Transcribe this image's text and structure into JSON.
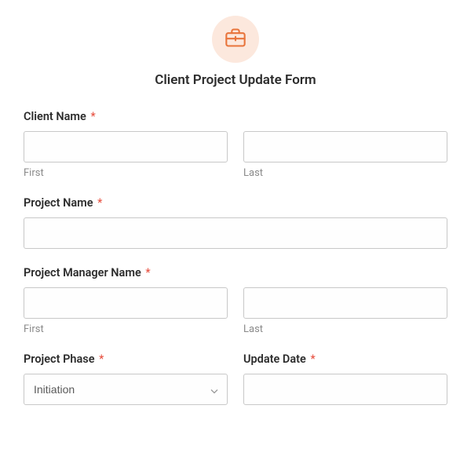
{
  "header": {
    "title": "Client Project Update Form"
  },
  "fields": {
    "client_name": {
      "label": "Client Name",
      "required_mark": "*",
      "first_sublabel": "First",
      "last_sublabel": "Last",
      "first_value": "",
      "last_value": ""
    },
    "project_name": {
      "label": "Project Name",
      "required_mark": "*",
      "value": ""
    },
    "pm_name": {
      "label": "Project Manager Name",
      "required_mark": "*",
      "first_sublabel": "First",
      "last_sublabel": "Last",
      "first_value": "",
      "last_value": ""
    },
    "project_phase": {
      "label": "Project Phase",
      "required_mark": "*",
      "selected": "Initiation"
    },
    "update_date": {
      "label": "Update Date",
      "required_mark": "*",
      "value": ""
    }
  }
}
